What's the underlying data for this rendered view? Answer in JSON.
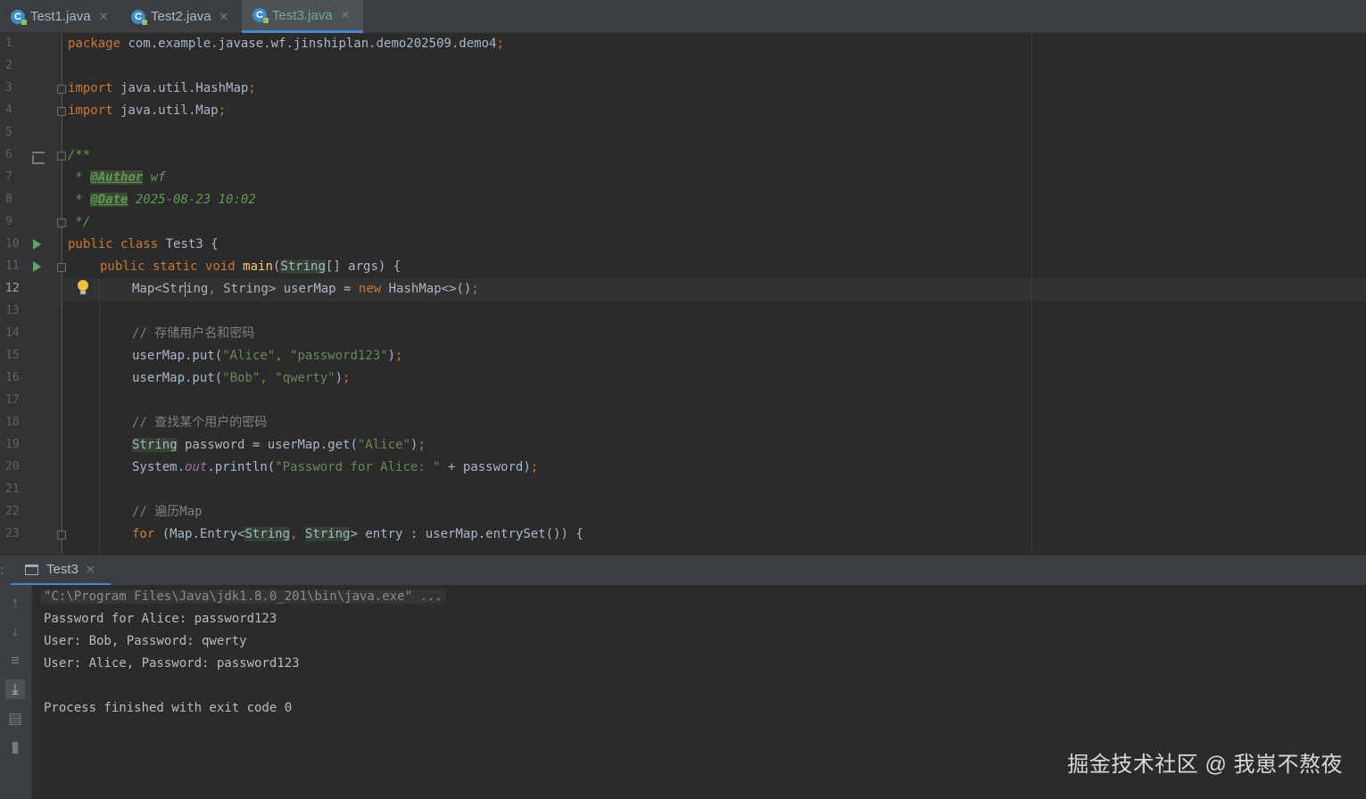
{
  "tabs": [
    {
      "label": "Test1.java",
      "active": false
    },
    {
      "label": "Test2.java",
      "active": false
    },
    {
      "label": "Test3.java",
      "active": true
    }
  ],
  "editor": {
    "line_numbers": [
      "1",
      "2",
      "3",
      "4",
      "5",
      "6",
      "7",
      "8",
      "9",
      "10",
      "11",
      "12",
      "13",
      "14",
      "15",
      "16",
      "17",
      "18",
      "19",
      "20",
      "21",
      "22",
      "23"
    ],
    "current_line": 12,
    "code": {
      "l1_kw": "package",
      "l1_rest": " com.example.javase.wf.jinshiplan.demo202509.demo4",
      "l1_semi": ";",
      "l3_kw": "import",
      "l3_rest": " java.util.HashMap",
      "l4_kw": "import",
      "l4_rest": " java.util.Map",
      "semi": ";",
      "l6": "/**",
      "l7_star": " * ",
      "l7_tag": "@Author",
      "l7_val": " wf",
      "l8_star": " * ",
      "l8_tag": "@Date",
      "l8_val": " 2025-08-23 10:02",
      "l9": " */",
      "l10_kw": "public class",
      "l10_rest": " Test3 {",
      "l11_kw": "public static void",
      "l11_fn": "main",
      "l11_p1": "(",
      "l11_type": "String",
      "l11_rest": "[] args) {",
      "l12_a": "Map<Str",
      "l12_b": "ing",
      "l12_comma": ", ",
      "l12_type": "String",
      "l12_mid": "> userMap = ",
      "l12_new": "new",
      "l12_end": " HashMap<>()",
      "l14": "// 存储用户名和密码",
      "l15_a": "userMap.put(",
      "l15_s1": "\"Alice\"",
      "l15_c": ", ",
      "l15_s2": "\"password123\"",
      "l15_e": ")",
      "l16_a": "userMap.put(",
      "l16_s1": "\"Bob\"",
      "l16_c": ", ",
      "l16_s2": "\"qwerty\"",
      "l16_e": ")",
      "l18": "// 查找某个用户的密码",
      "l19_type": "String",
      "l19_a": " password = userMap.get(",
      "l19_s": "\"Alice\"",
      "l19_e": ")",
      "l20_a": "System.",
      "l20_out": "out",
      "l20_b": ".println(",
      "l20_s": "\"Password for Alice: \"",
      "l20_c": " + password)",
      "l22": "// 遍历Map",
      "l23_kw": "for",
      "l23_a": " (Map.Entry<",
      "l23_t1": "String",
      "l23_comma": ", ",
      "l23_t2": "String",
      "l23_b": "> entry : userMap.entrySet()) {"
    }
  },
  "run_panel": {
    "tab_label": "Test3",
    "console_lines": [
      "\"C:\\Program Files\\Java\\jdk1.8.0_201\\bin\\java.exe\" ...",
      "Password for Alice: password123",
      "User: Bob, Password: qwerty",
      "User: Alice, Password: password123",
      "",
      "Process finished with exit code 0"
    ]
  },
  "watermark": "掘金技术社区 @ 我崽不熬夜"
}
